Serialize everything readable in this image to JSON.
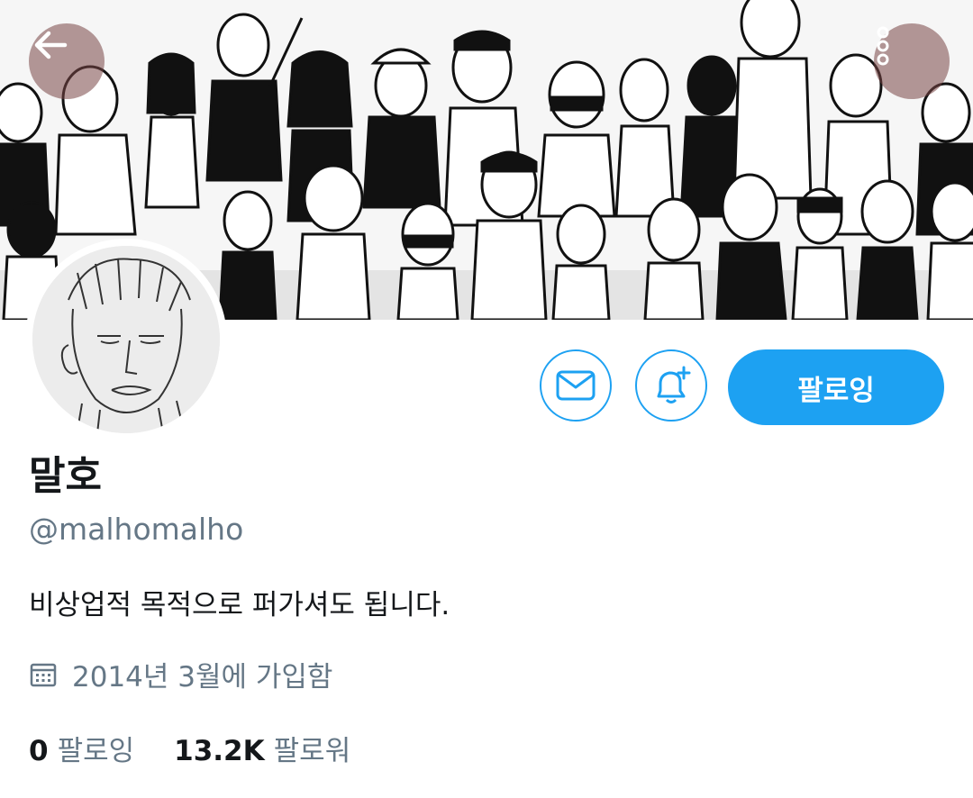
{
  "header": {
    "back_icon": "arrow-left-icon",
    "more_icon": "more-vertical-icon"
  },
  "profile": {
    "display_name": "말호",
    "handle": "@malhomalho",
    "bio": "비상업적 목적으로 퍼가셔도 됩니다.",
    "joined_icon": "calendar-icon",
    "joined": "2014년 3월에 가입함"
  },
  "actions": {
    "message_icon": "mail-icon",
    "notify_icon": "bell-plus-icon",
    "follow_label": "팔로잉"
  },
  "stats": {
    "following_count": "0",
    "following_label": "팔로잉",
    "followers_count": "13.2K",
    "followers_label": "팔로워"
  },
  "colors": {
    "accent": "#1da1f2",
    "secondary_text": "#657786",
    "primary_text": "#14171a"
  }
}
